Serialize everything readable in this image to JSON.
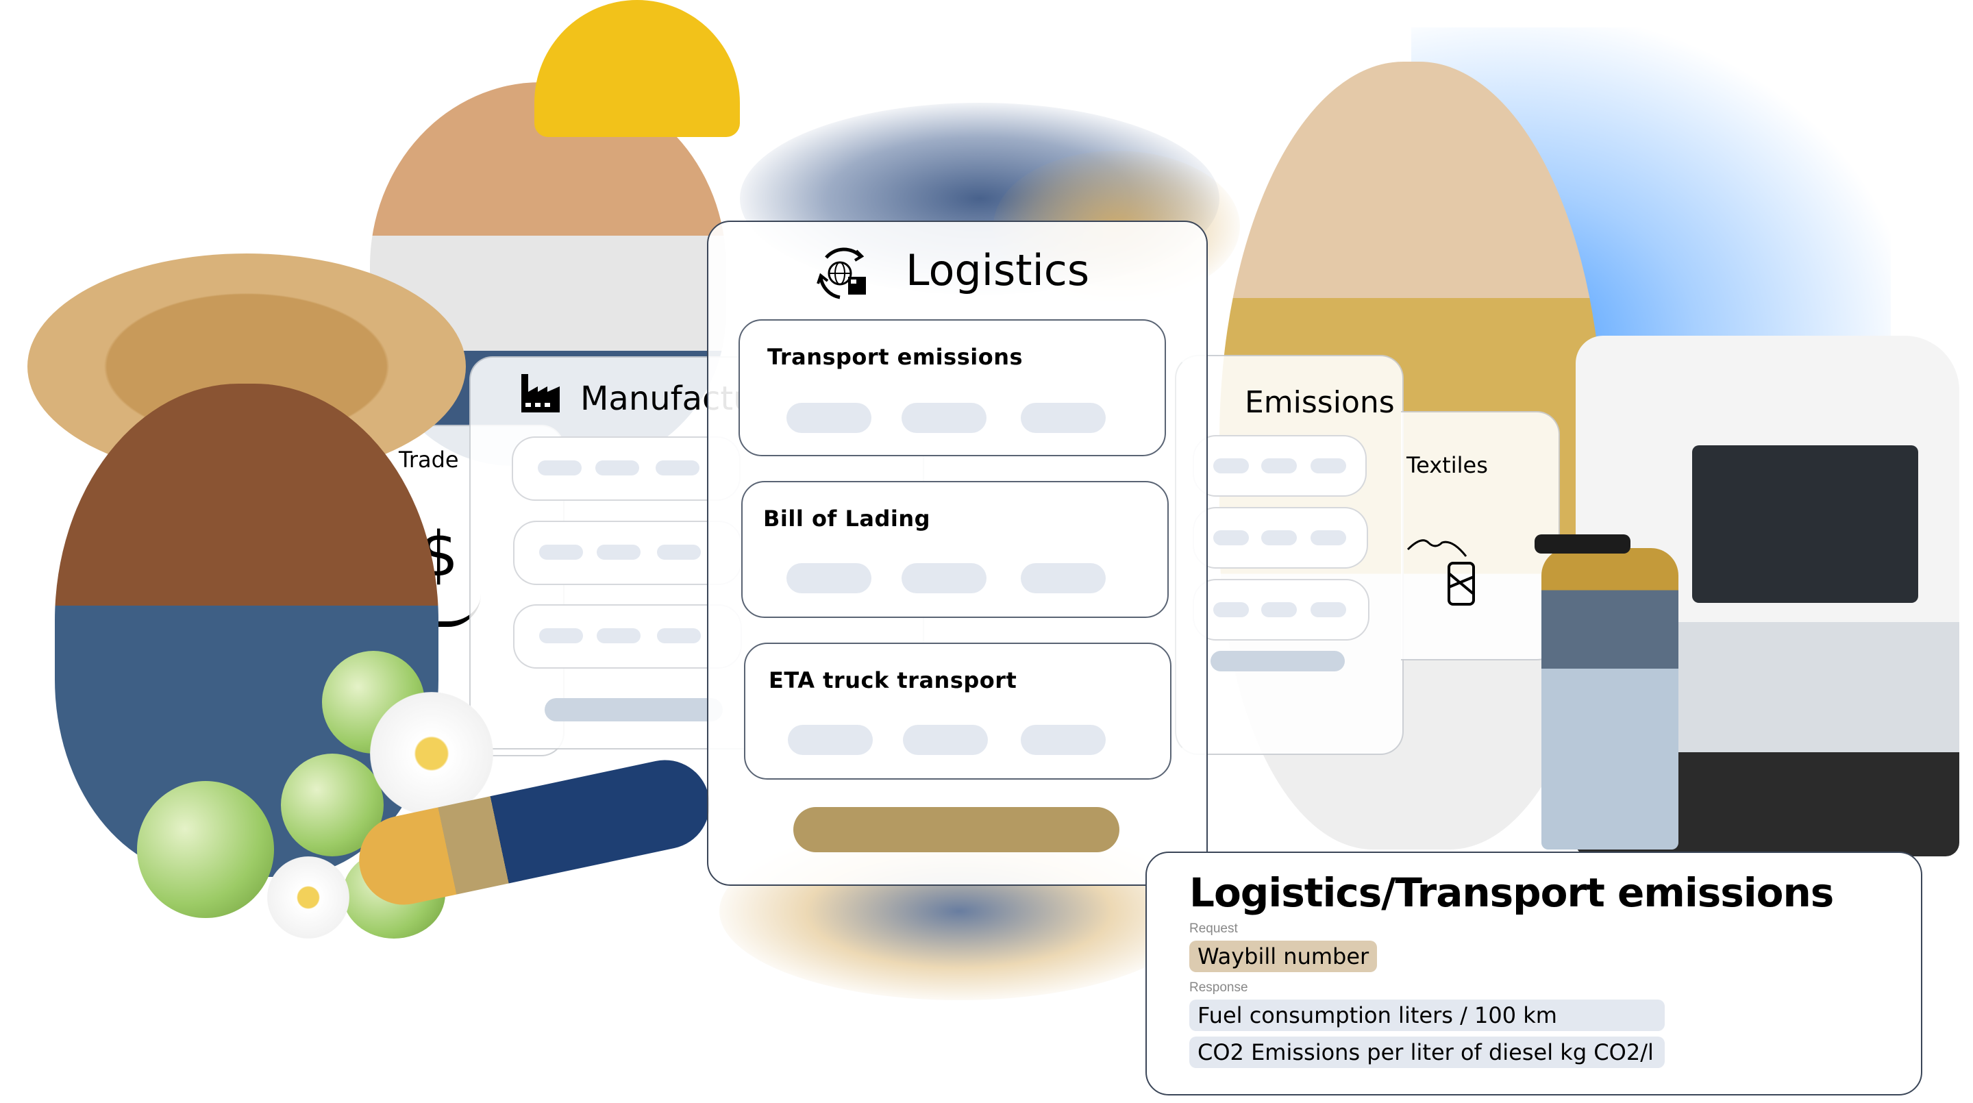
{
  "cards": {
    "trade": {
      "title": "Trade",
      "icon": "dollar-exchange-icon"
    },
    "manufacturing": {
      "title": "Manufacturing",
      "icon": "factory-icon"
    },
    "logistics": {
      "title": "Logistics",
      "icon": "globe-box-cycle-icon",
      "items": [
        {
          "label": "Transport emissions"
        },
        {
          "label": "Bill of Lading"
        },
        {
          "label": "ETA truck transport"
        }
      ],
      "button_color": "#b49a62"
    },
    "emissions": {
      "title": "Emissions"
    },
    "textiles": {
      "title": "Textiles",
      "icon": "tshirt-spool-icon"
    }
  },
  "detail": {
    "title": "Logistics/Transport emissions",
    "request_label": "Request",
    "request_fields": [
      "Waybill number"
    ],
    "response_label": "Response",
    "response_fields": [
      "Fuel consumption liters / 100 km",
      "CO2 Emissions per liter of diesel kg CO2/l"
    ],
    "request_chip_color": "#dccbb0",
    "response_chip_color": "#e3e8f0"
  }
}
